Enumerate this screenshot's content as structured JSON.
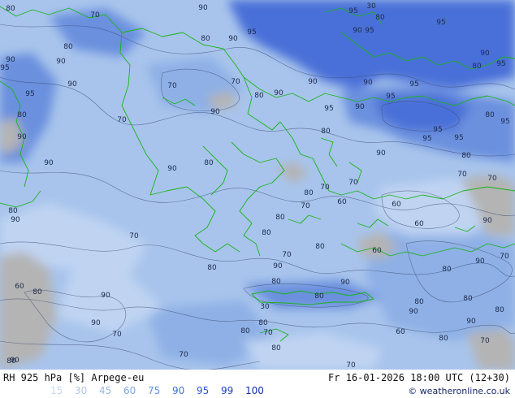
{
  "footer": {
    "title": "RH 925 hPa [%] Arpege-eu",
    "datetime": "Fr 16-01-2026 18:00 UTC (12+30)",
    "copyright": "© weatheronline.co.uk"
  },
  "legend": {
    "values": [
      "15",
      "30",
      "45",
      "60",
      "75",
      "90",
      "95",
      "99",
      "100"
    ],
    "colors": [
      "#c8d8f0",
      "#b0c8ec",
      "#98b8e8",
      "#80a8e4",
      "#6090e0",
      "#4070dc",
      "#2a58d4",
      "#1840c0",
      "#1030a8"
    ]
  },
  "map": {
    "colors": {
      "base": "#a8c4ec",
      "light": "#c0d4f2",
      "mid": "#8eb0e6",
      "dark": "#6a90de",
      "deep": "#4a70d8",
      "gray": "#b4b4b4",
      "coast": "#18b418",
      "contour": "#3c4a70"
    },
    "contour_labels": [
      "80",
      "70",
      "90",
      "95",
      "30",
      "80",
      "95",
      "80",
      "90",
      "95",
      "90",
      "95",
      "80",
      "90",
      "95",
      "90",
      "90",
      "80",
      "95",
      "90",
      "70",
      "70",
      "90",
      "95",
      "95",
      "90",
      "95",
      "90",
      "80",
      "95",
      "90",
      "80",
      "95",
      "80",
      "70",
      "90",
      "95",
      "95",
      "90",
      "95",
      "80",
      "90",
      "90",
      "80",
      "70",
      "90",
      "80",
      "70",
      "70",
      "60",
      "80",
      "80",
      "70",
      "70",
      "60",
      "90",
      "80",
      "90",
      "60",
      "60",
      "70",
      "80",
      "80",
      "70",
      "80",
      "90",
      "80",
      "90",
      "70",
      "80",
      "90",
      "80",
      "80",
      "90",
      "30",
      "60",
      "80",
      "90",
      "80",
      "90",
      "80",
      "80",
      "70",
      "70",
      "80",
      "60",
      "90",
      "80",
      "70",
      "80",
      "70",
      "80",
      "70",
      "90"
    ]
  }
}
